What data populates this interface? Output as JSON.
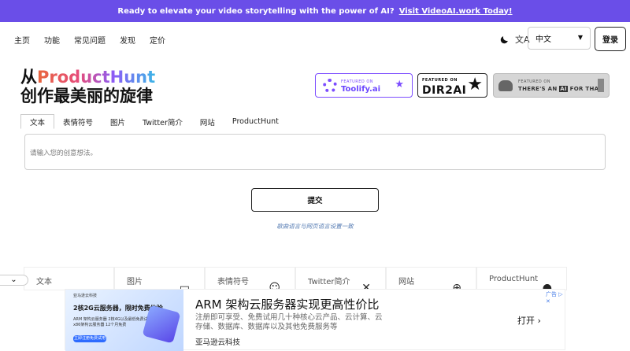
{
  "banner": {
    "text": "Ready to elevate your video storytelling with the power of AI?",
    "link": "Visit VideoAI.work Today!"
  },
  "nav": {
    "links": [
      "主页",
      "功能",
      "常见问题",
      "发现",
      "定价"
    ],
    "language": "中文",
    "login": "登录"
  },
  "hero": {
    "line1_prefix": "从",
    "line1_highlight": "ProductHunt",
    "line2": "创作最美丽的旋律"
  },
  "badges": {
    "toolify": {
      "small": "FEATURED ON",
      "name": "Toolify.ai"
    },
    "dir2ai": {
      "small": "FEATURED ON",
      "name": "DIR2AI"
    },
    "theresanai": {
      "small": "FEATURED ON",
      "name_pre": "THERE'S AN",
      "name_ai": "AI",
      "name_post": "FOR THAT"
    }
  },
  "tabs": [
    "文本",
    "表情符号",
    "图片",
    "Twitter简介",
    "网站",
    "ProductHunt"
  ],
  "input": {
    "placeholder": "请输入您的创意想法。"
  },
  "submit_label": "提交",
  "hint": "歌曲语言与网页语言设置一致",
  "cards": [
    {
      "label": "文本"
    },
    {
      "label": "图片",
      "icon": "image-icon"
    },
    {
      "label": "表情符号",
      "icon": "smile-icon"
    },
    {
      "label": "Twitter简介",
      "icon": "x-icon"
    },
    {
      "label": "网站",
      "icon": "globe-icon"
    },
    {
      "label": "ProductHunt",
      "icon": "producthunt-icon"
    }
  ],
  "ad": {
    "img_l1": "亚马逊云科技",
    "img_l2": "2核2G云服务器，限时免费体验",
    "img_l3": "ARM 架构云服务器 2核4G以及最低免费试用",
    "img_l3b": "x86架构云服务器 12个月免费",
    "img_btn": "立即注册免费试用",
    "title": "ARM 架构云服务器实现更高性价比",
    "desc": "注册即可享受、免费试用几十种核心云产品、云计算、云存储、数据库、数据库以及其他免费服务等",
    "brand": "亚马逊云科技",
    "cta": "打开",
    "mark": "广告"
  },
  "colors": {
    "banner": "#6a4ee8",
    "accent_purple": "#7c4dff",
    "hint": "#5a7fb5"
  }
}
